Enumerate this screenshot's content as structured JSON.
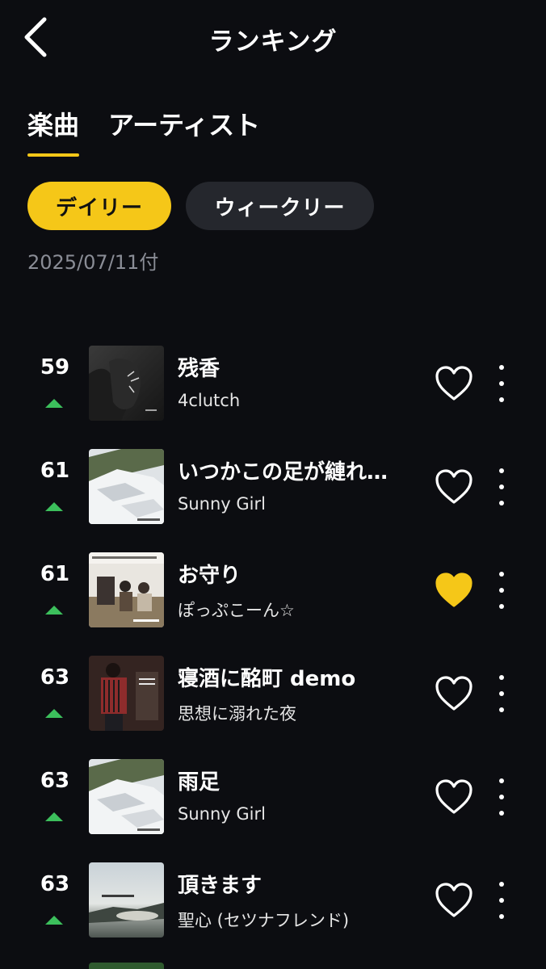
{
  "header": {
    "title": "ランキング"
  },
  "tabs": [
    {
      "label": "楽曲",
      "active": true
    },
    {
      "label": "アーティスト",
      "active": false
    }
  ],
  "period": {
    "daily_label": "デイリー",
    "weekly_label": "ウィークリー",
    "selected": "デイリー"
  },
  "date": "2025/07/11付",
  "colors": {
    "accent": "#f5c718",
    "background": "#0c0d11",
    "trend_up": "#3cbf5c",
    "chip_inactive": "#25272d",
    "subtle_text": "#8a8d96"
  },
  "songs": [
    {
      "rank": "59",
      "trend": "up",
      "title": "残香",
      "artist": "4clutch",
      "liked": false
    },
    {
      "rank": "61",
      "trend": "up",
      "title": "いつかこの足が縺れ…",
      "artist": "Sunny Girl",
      "liked": false
    },
    {
      "rank": "61",
      "trend": "up",
      "title": "お守り",
      "artist": "ぽっぷこーん☆",
      "liked": true
    },
    {
      "rank": "63",
      "trend": "up",
      "title": "寝酒に酩町 demo",
      "artist": "思想に溺れた夜",
      "liked": false
    },
    {
      "rank": "63",
      "trend": "up",
      "title": "雨足",
      "artist": "Sunny Girl",
      "liked": false
    },
    {
      "rank": "63",
      "trend": "up",
      "title": "頂きます",
      "artist": "聖心 (セツナフレンド)",
      "liked": false
    }
  ],
  "icons": {
    "back": "chevron-left-icon",
    "like": "heart-icon",
    "more": "more-vertical-icon",
    "trend": "trend-up-icon"
  }
}
